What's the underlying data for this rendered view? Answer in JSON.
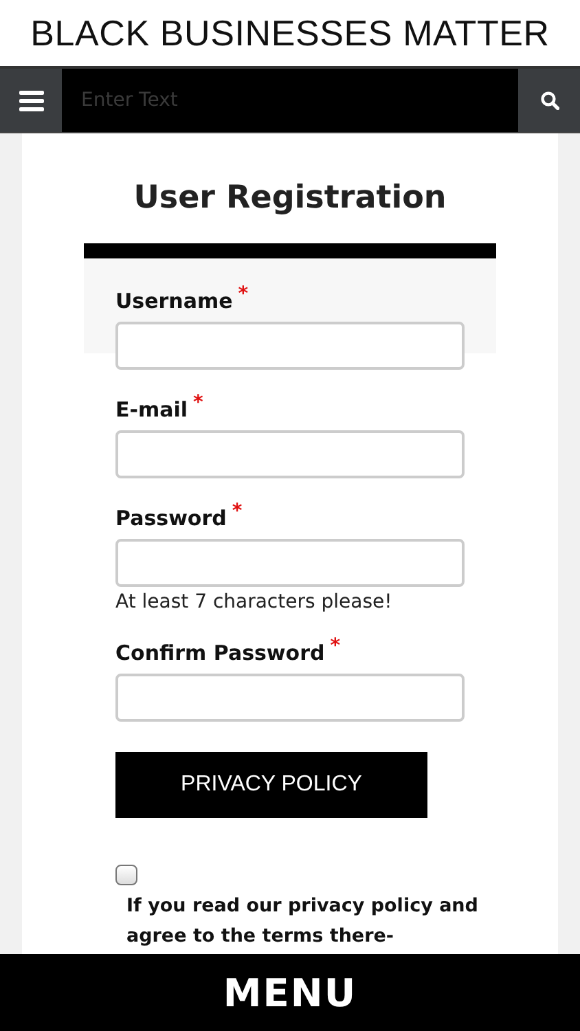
{
  "site_title": "BLACK BUSINESSES MATTER",
  "navbar": {
    "search": {
      "placeholder": "Enter Text"
    }
  },
  "form": {
    "title": "User Registration",
    "fields": [
      {
        "label": "Username",
        "required_mark": "*"
      },
      {
        "label": "E-mail",
        "required_mark": "*"
      },
      {
        "label": "Password",
        "required_mark": "*",
        "hint": "At least 7 characters please!"
      },
      {
        "label": "Confirm Password",
        "required_mark": "*"
      }
    ],
    "privacy_button": "PRIVACY POLICY",
    "consent": {
      "checked": false,
      "text": "If you read our privacy policy and agree to the terms there-"
    }
  },
  "bottom_bar": {
    "label": "MENU"
  }
}
